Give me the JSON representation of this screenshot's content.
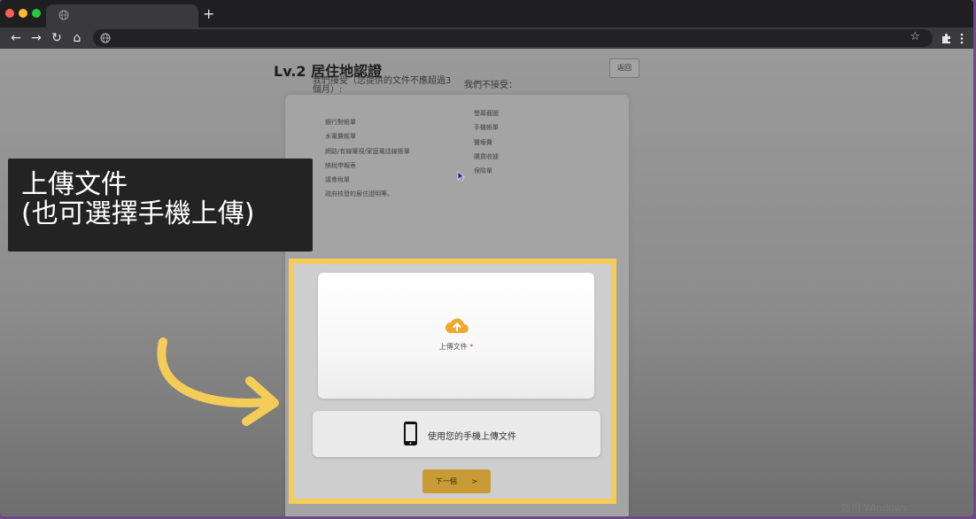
{
  "browser": {
    "tab": {
      "title": ""
    },
    "new_tab_symbol": "+",
    "toolbar": {
      "back": "←",
      "forward": "→",
      "reload": "↻",
      "home": "⌂",
      "address": "",
      "bookmark": "☆"
    }
  },
  "page": {
    "title": "Lv.2 居住地認證",
    "back_button": "返回",
    "accept_heading": "我們接受（您提供的文件不應超過3個月）:",
    "reject_heading": "我們不接受：",
    "accepted": [
      "銀行對帳單",
      "水電費帳單",
      "網路/有線電視/家庭電話線帳單",
      "納稅申報表",
      "議會稅單",
      "政府核發的居住證明等。"
    ],
    "rejected": [
      "螢幕截圖",
      "手機帳單",
      "醫療費",
      "購買收據",
      "保險單"
    ],
    "upload_label": "上傳文件",
    "upload_required": "*",
    "mobile_label": "使用您的手機上傳文件",
    "next_label": "下一個",
    "next_chevron": ">",
    "watermark": "啟用 Windows"
  },
  "caption": {
    "line1": "上傳文件",
    "line2": "(也可選擇手機上傳)"
  },
  "colors": {
    "highlight": "#f4cd58",
    "next_button": "#c99b36",
    "cloud": "#f0a92e"
  },
  "icons": [
    "globe-icon",
    "back-arrow-icon",
    "forward-arrow-icon",
    "reload-icon",
    "home-icon",
    "star-icon",
    "extensions-icon",
    "menu-icon",
    "cloud-upload-icon",
    "phone-icon",
    "cursor-icon",
    "arrow-icon"
  ]
}
